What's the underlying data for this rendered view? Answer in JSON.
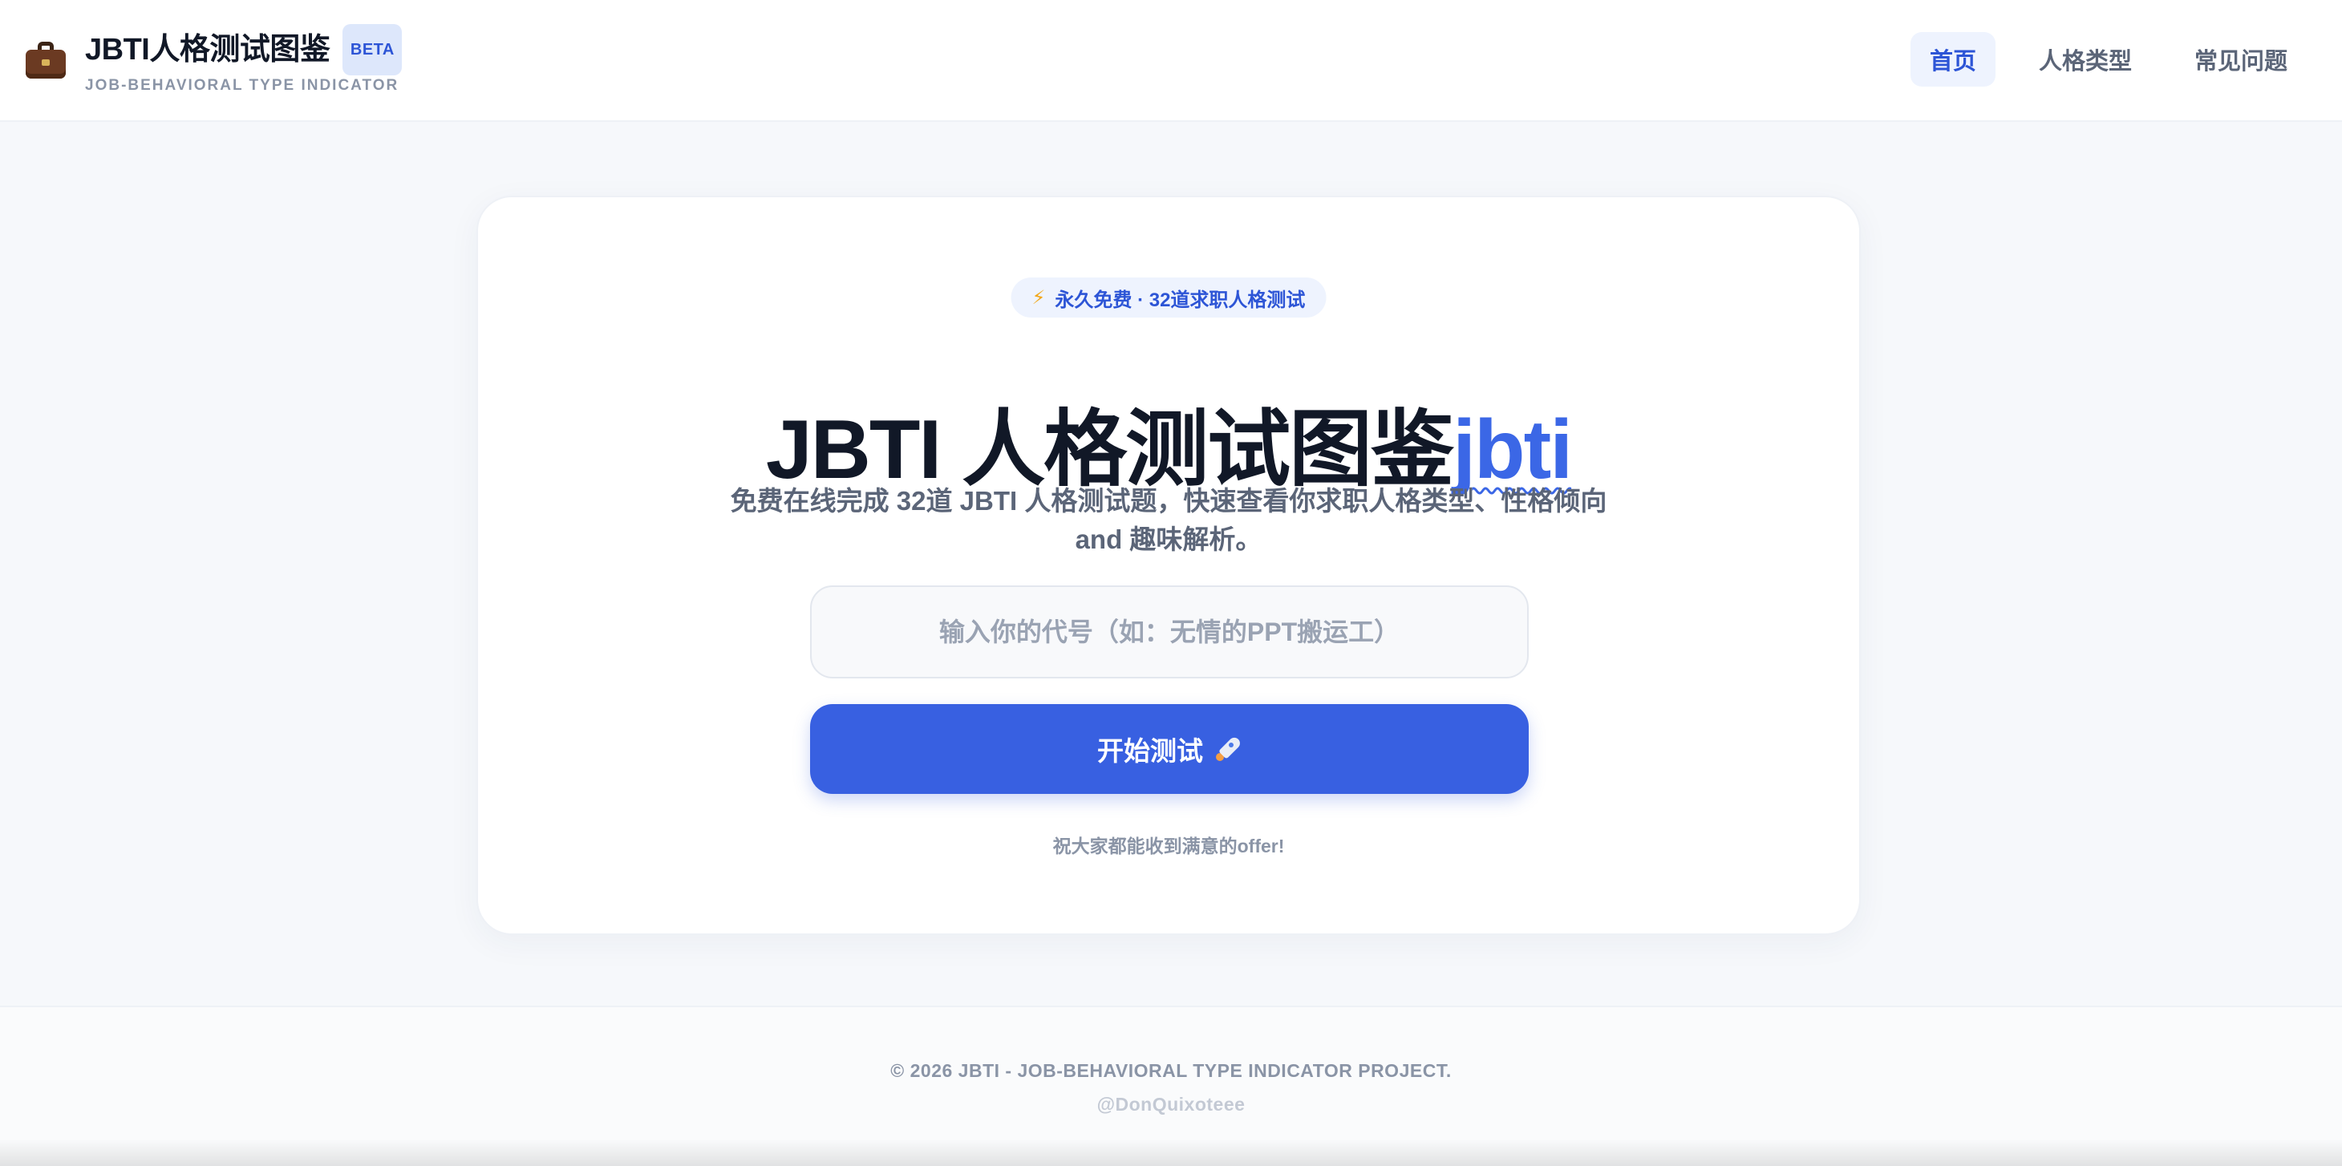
{
  "header": {
    "brand_icon": "briefcase-icon",
    "title": "JBTI人格测试图鉴",
    "badge": "BETA",
    "subtitle": "JOB-BEHAVIORAL TYPE INDICATOR",
    "nav": [
      {
        "label": "首页",
        "active": true
      },
      {
        "label": "人格类型",
        "active": false
      },
      {
        "label": "常见问题",
        "active": false
      }
    ]
  },
  "hero": {
    "pill_icon": "lightning-icon",
    "pill_text": "永久免费 · 32道求职人格测试",
    "headline_main": "JBTI 人格测试图鉴",
    "headline_accent": "jbti",
    "subtitle": "免费在线完成 32道 JBTI 人格测试题，快速查看你求职人格类型、性格倾向 and 趣味解析。",
    "input_placeholder": "输入你的代号（如：无情的PPT搬运工）",
    "input_value": "",
    "start_button": "开始测试",
    "start_button_icon": "rocket-icon",
    "wish": "祝大家都能收到满意的offer!"
  },
  "footer": {
    "copyright": "© 2026 JBTI - JOB-BEHAVIORAL TYPE INDICATOR PROJECT.",
    "author": "@DonQuixoteee"
  },
  "colors": {
    "accent": "#3860e1",
    "accent_light": "#eef3fe",
    "text_dark": "#111827",
    "text_muted": "#5b6578",
    "background": "#f6f8fb"
  }
}
